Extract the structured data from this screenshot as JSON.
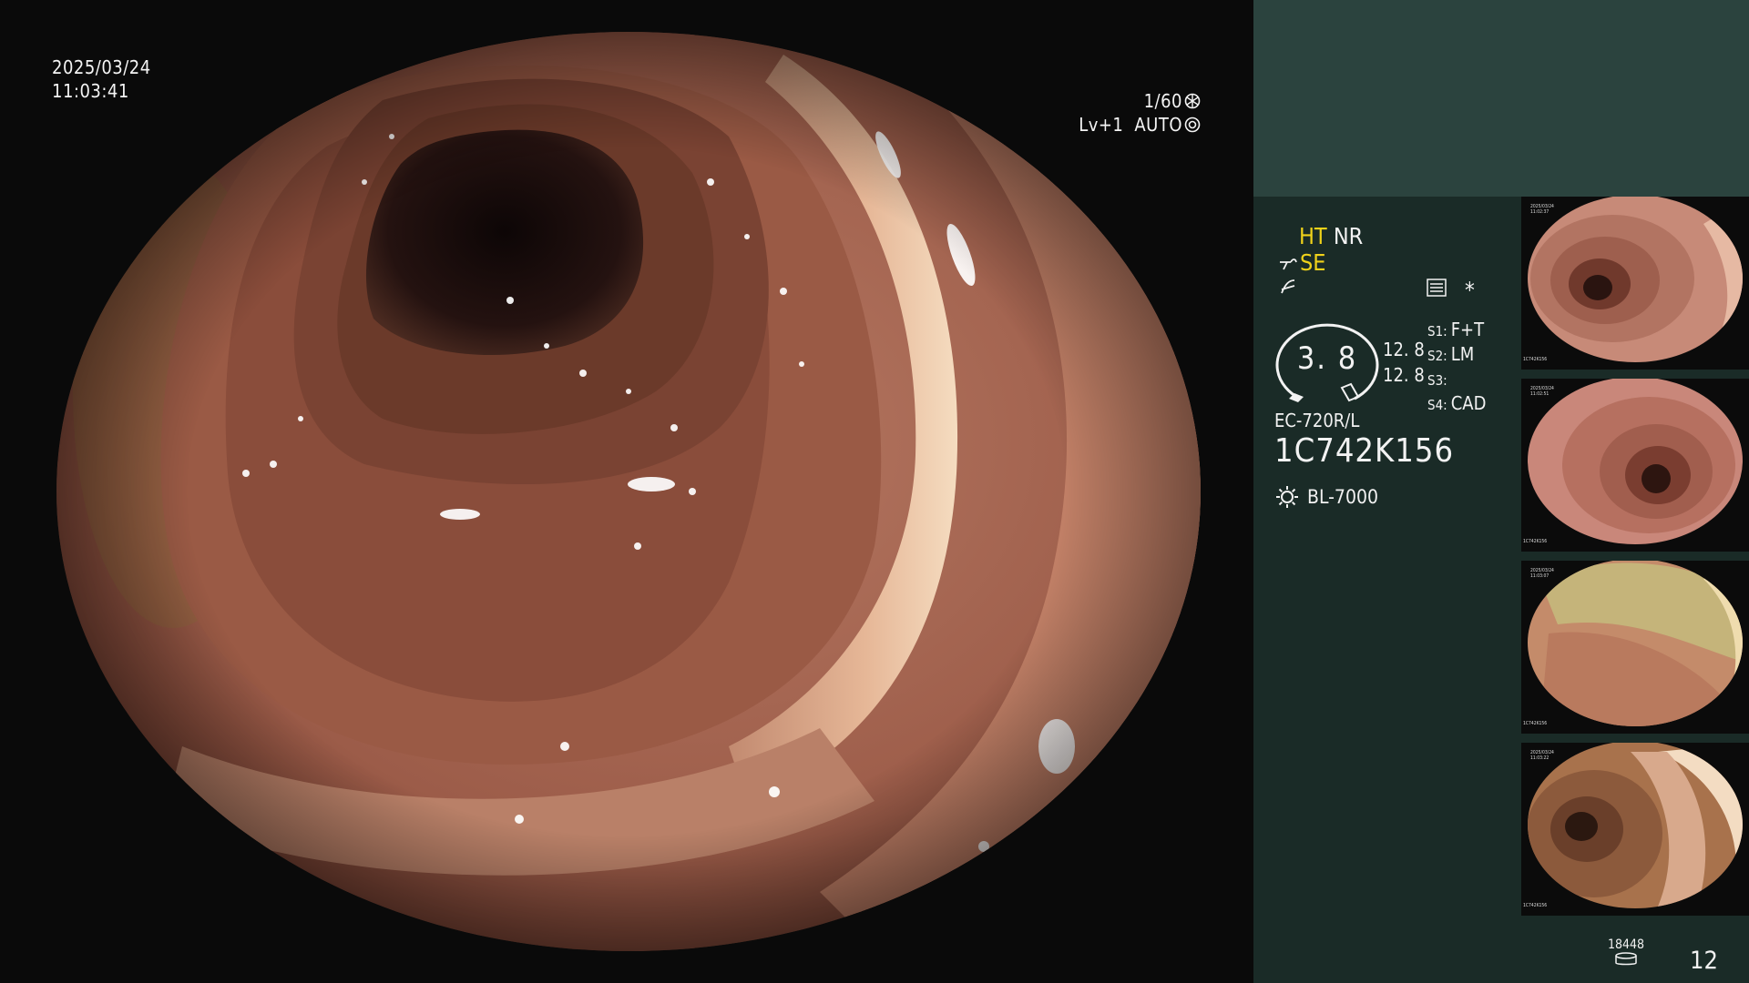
{
  "overlay": {
    "date": "2025/03/24",
    "time": "11:03:41",
    "shutter_speed": "1/60",
    "level": "Lv+1",
    "iris_mode": "AUTO"
  },
  "side_panel": {
    "ht": "HT",
    "nr": "NR",
    "se": "SE",
    "gauge_value": "3. 8",
    "values": [
      "12. 8",
      "12. 8"
    ],
    "slots": [
      {
        "key": "S1:",
        "value": "F+T"
      },
      {
        "key": "S2:",
        "value": "LM"
      },
      {
        "key": "S3:",
        "value": ""
      },
      {
        "key": "S4:",
        "value": "CAD"
      }
    ],
    "scope_model": "EC-720R/L",
    "scope_serial": "1C742K156",
    "light_source": "BL-7000",
    "star": "*"
  },
  "thumbnails": [
    {
      "date": "2025/03/24",
      "time": "11:02:37",
      "serial": "1C742K156"
    },
    {
      "date": "2025/03/24",
      "time": "11:02:51",
      "serial": "1C742K156"
    },
    {
      "date": "2025/03/24",
      "time": "11:03:07",
      "serial": "1C742K156"
    },
    {
      "date": "2025/03/24",
      "time": "11:03:22",
      "serial": "1C742K156"
    }
  ],
  "footer": {
    "storage_count": "18448",
    "image_count": "12"
  },
  "colors": {
    "panel_top": "#2b433e",
    "panel_body": "#1a2b27",
    "highlight_yellow": "#f0d21a"
  },
  "icons": [
    "shutter-icon",
    "iris-icon",
    "scope-icon",
    "filter-icon",
    "settings-panel-icon",
    "lamp-icon",
    "storage-icon"
  ]
}
